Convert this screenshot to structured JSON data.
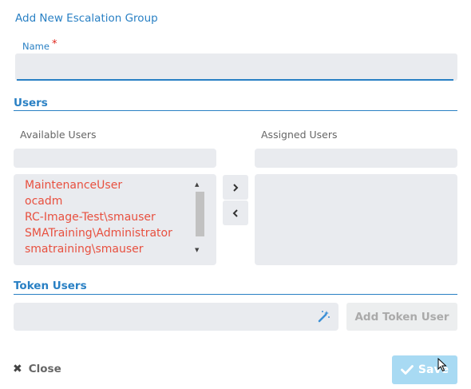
{
  "dialog": {
    "title": "Add New Escalation Group"
  },
  "name_field": {
    "label": "Name",
    "required_mark": "*",
    "value": ""
  },
  "users_section": {
    "title": "Users",
    "available": {
      "label": "Available Users",
      "search_value": "",
      "items": [
        "MaintenanceUser",
        "ocadm",
        "RC-Image-Test\\smauser",
        "SMATraining\\Administrator",
        "smatraining\\smauser"
      ]
    },
    "assigned": {
      "label": "Assigned Users",
      "search_value": "",
      "items": []
    },
    "move_right_glyph": "›",
    "move_left_glyph": "‹"
  },
  "token_section": {
    "title": "Token Users",
    "input_value": "",
    "add_button_label": "Add Token User"
  },
  "footer": {
    "close_label": "Close",
    "save_label": "Save"
  },
  "colors": {
    "accent": "#2980c4",
    "user_text": "#e8503f",
    "required": "#e0251b",
    "field_bg": "#e9ebef",
    "save_bg": "#a8daf3"
  }
}
